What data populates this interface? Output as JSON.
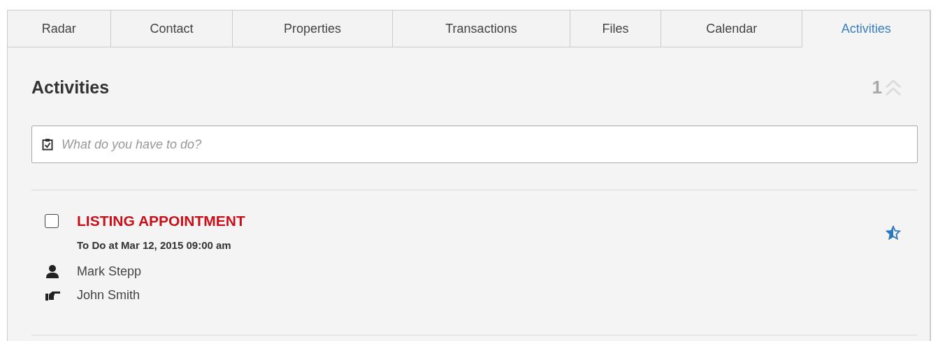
{
  "tabs": [
    {
      "label": "Radar",
      "selected": false
    },
    {
      "label": "Contact",
      "selected": false
    },
    {
      "label": "Properties",
      "selected": false
    },
    {
      "label": "Transactions",
      "selected": false
    },
    {
      "label": "Files",
      "selected": false
    },
    {
      "label": "Calendar",
      "selected": false
    },
    {
      "label": "Activities",
      "selected": true
    }
  ],
  "section": {
    "title": "Activities",
    "count": "1"
  },
  "new_activity": {
    "placeholder": "What do you have to do?"
  },
  "activities": [
    {
      "title": "LISTING APPOINTMENT",
      "checked": false,
      "due": "To Do at Mar 12, 2015 09:00 am",
      "people": [
        {
          "kind": "owner",
          "name": "Mark Stepp"
        },
        {
          "kind": "assignee",
          "name": "John Smith"
        }
      ]
    }
  ]
}
